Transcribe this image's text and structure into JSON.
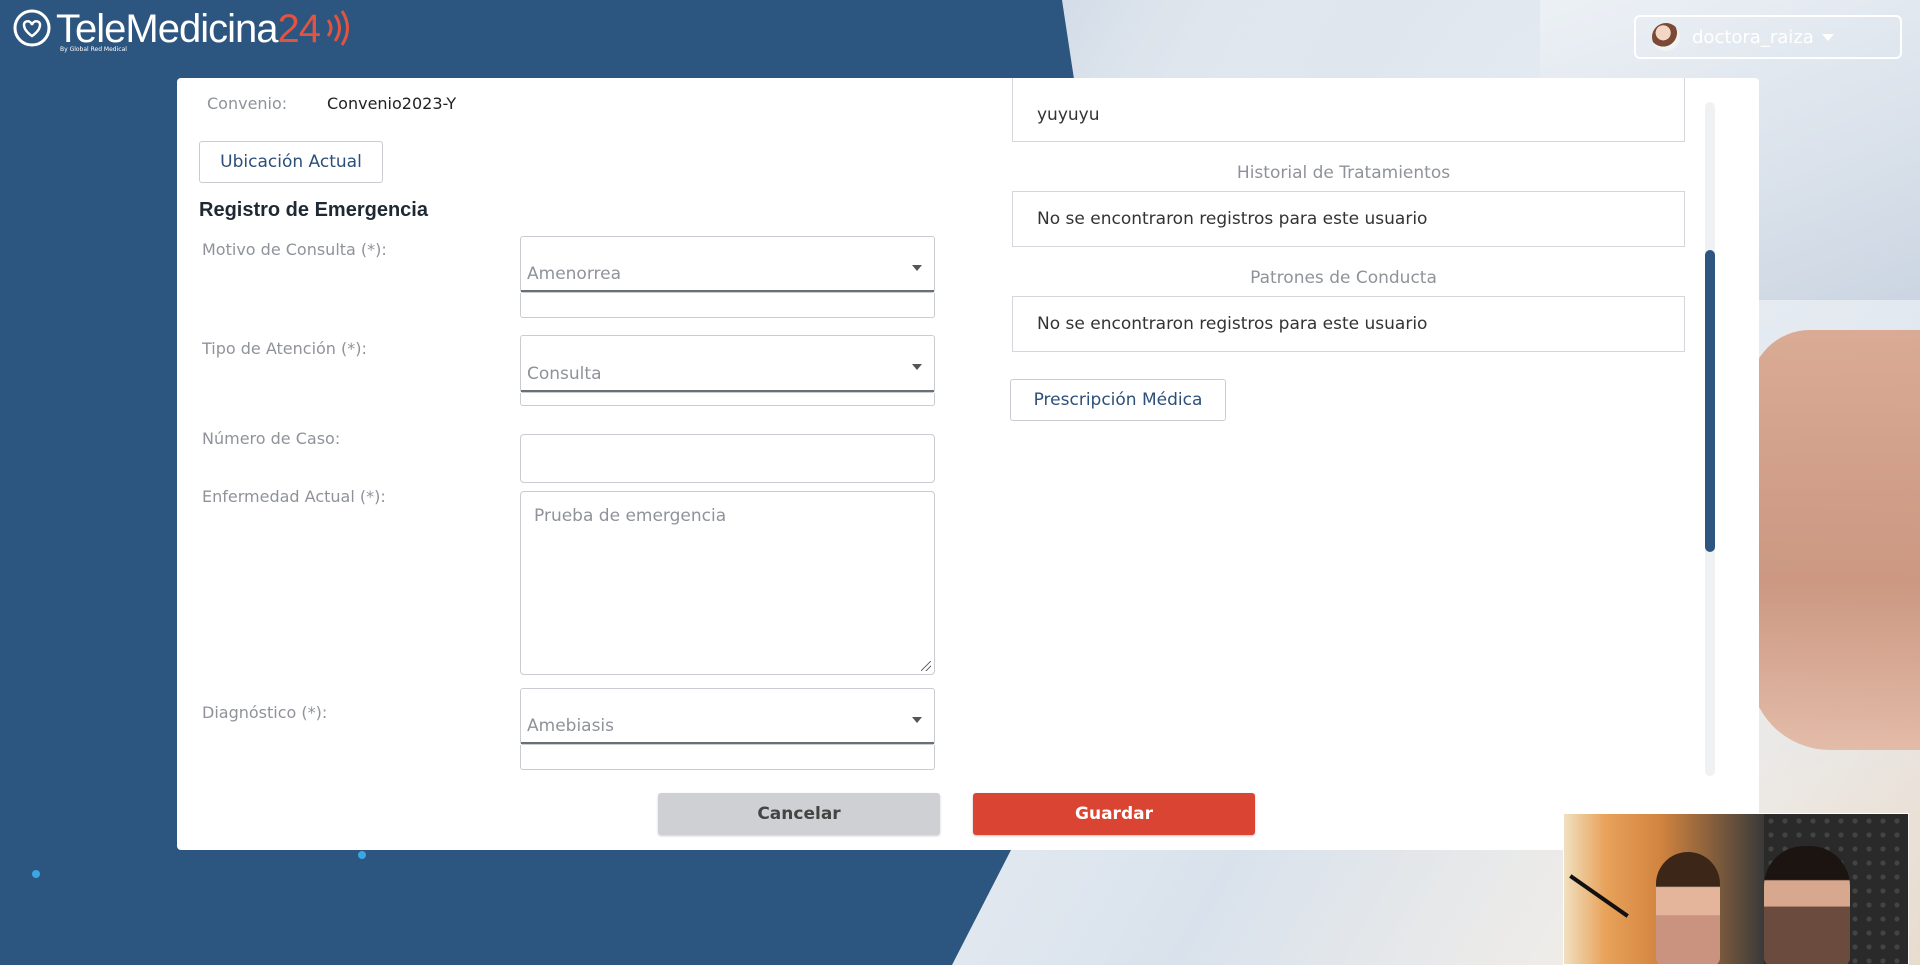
{
  "brand": {
    "name_part1": "TeleMedicina",
    "name_part2": "24",
    "tagline": "By Global Red Medical"
  },
  "user": {
    "username": "doctora_raiza"
  },
  "form": {
    "convenio_label": "Convenio:",
    "convenio_value": "Convenio2023-Y",
    "location_button": "Ubicación Actual",
    "section_title": "Registro de Emergencia",
    "motivo_label": "Motivo de Consulta (*):",
    "motivo_value": "Amenorrea",
    "tipo_label": "Tipo de Atención (*):",
    "tipo_value": "Consulta",
    "caso_label": "Número de Caso:",
    "caso_value": "",
    "enfermedad_label": "Enfermedad Actual (*):",
    "enfermedad_placeholder": "Prueba de emergencia",
    "diagnostico_label": "Diagnóstico (*):",
    "diagnostico_value": "Amebiasis"
  },
  "right": {
    "top_field_value": "yuyuyu",
    "historial_caption": "Historial de Tratamientos",
    "historial_text": "No se encontraron registros para este usuario",
    "patrones_caption": "Patrones de Conducta",
    "patrones_text": "No se encontraron registros para este usuario",
    "prescripcion_button": "Prescripción Médica"
  },
  "footer": {
    "cancel_label": "Cancelar",
    "save_label": "Guardar"
  },
  "colors": {
    "brand_blue": "#2c5580",
    "accent_red": "#d94532",
    "cancel_gray": "#cfd0d4"
  },
  "icons": {
    "logo": "stethoscope-heart-icon",
    "signal": "signal-waves-icon",
    "dropdown": "caret-down-icon"
  }
}
